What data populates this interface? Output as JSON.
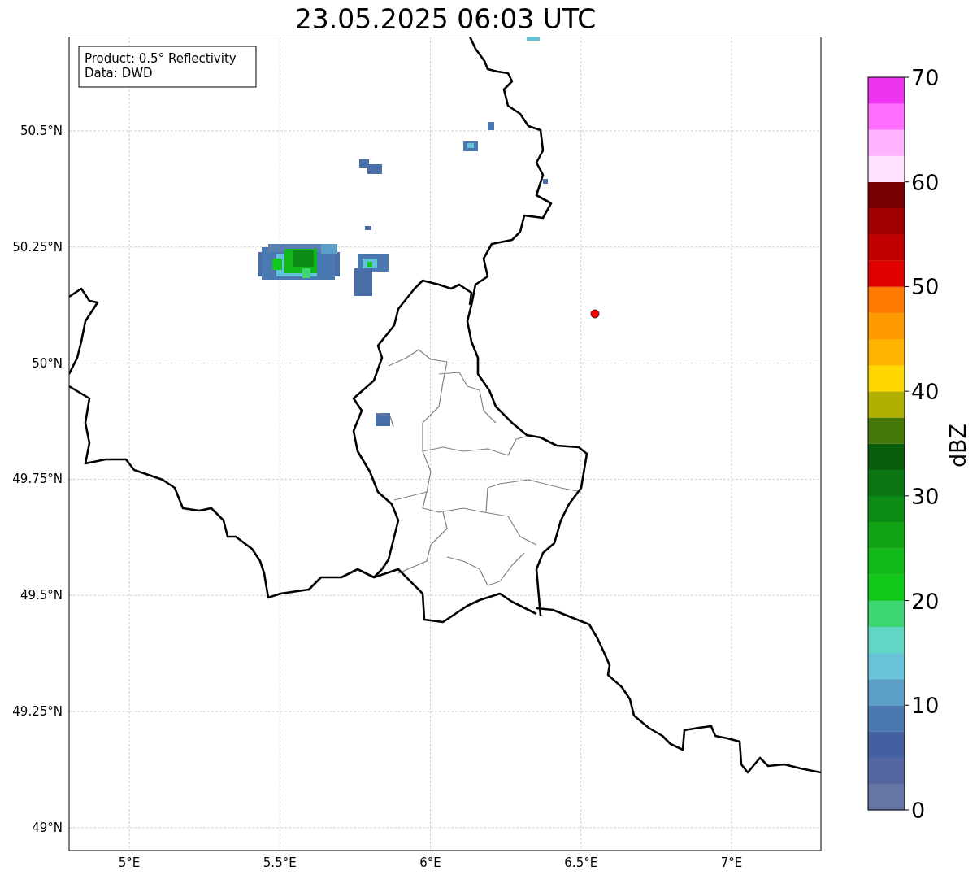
{
  "title": "23.05.2025 06:03 UTC",
  "info_box": [
    "Product: 0.5° Reflectivity",
    "Data: DWD"
  ],
  "map": {
    "lat_labels": [
      "50.5°N",
      "50.25°N",
      "50°N",
      "49.75°N",
      "49.5°N",
      "49.25°N",
      "49°N"
    ],
    "lon_labels": [
      "5°E",
      "5.5°E",
      "6°E",
      "6.5°E",
      "7°E"
    ],
    "marker": {
      "color": "#ff0000"
    }
  },
  "colorbar": {
    "label": "dBZ",
    "ticks": [
      "70",
      "60",
      "50",
      "40",
      "30",
      "20",
      "10",
      "0"
    ],
    "segments": [
      {
        "color": "#6575a5"
      },
      {
        "color": "#5467a0"
      },
      {
        "color": "#4360a0"
      },
      {
        "color": "#4a78b0"
      },
      {
        "color": "#5b9ec6"
      },
      {
        "color": "#68c2d8"
      },
      {
        "color": "#62d6c4"
      },
      {
        "color": "#3dd672"
      },
      {
        "color": "#10c81a"
      },
      {
        "color": "#10b818"
      },
      {
        "color": "#10a414"
      },
      {
        "color": "#0c8c14"
      },
      {
        "color": "#0a7614"
      },
      {
        "color": "#085e0c"
      },
      {
        "color": "#467808"
      },
      {
        "color": "#b0b000"
      },
      {
        "color": "#ffd700"
      },
      {
        "color": "#ffb300"
      },
      {
        "color": "#ff9900"
      },
      {
        "color": "#ff7a00"
      },
      {
        "color": "#e00000"
      },
      {
        "color": "#c00000"
      },
      {
        "color": "#a00000"
      },
      {
        "color": "#780000"
      },
      {
        "color": "#ffe0ff"
      },
      {
        "color": "#ffb3ff"
      },
      {
        "color": "#ff6eff"
      },
      {
        "color": "#ee33ee"
      }
    ]
  }
}
